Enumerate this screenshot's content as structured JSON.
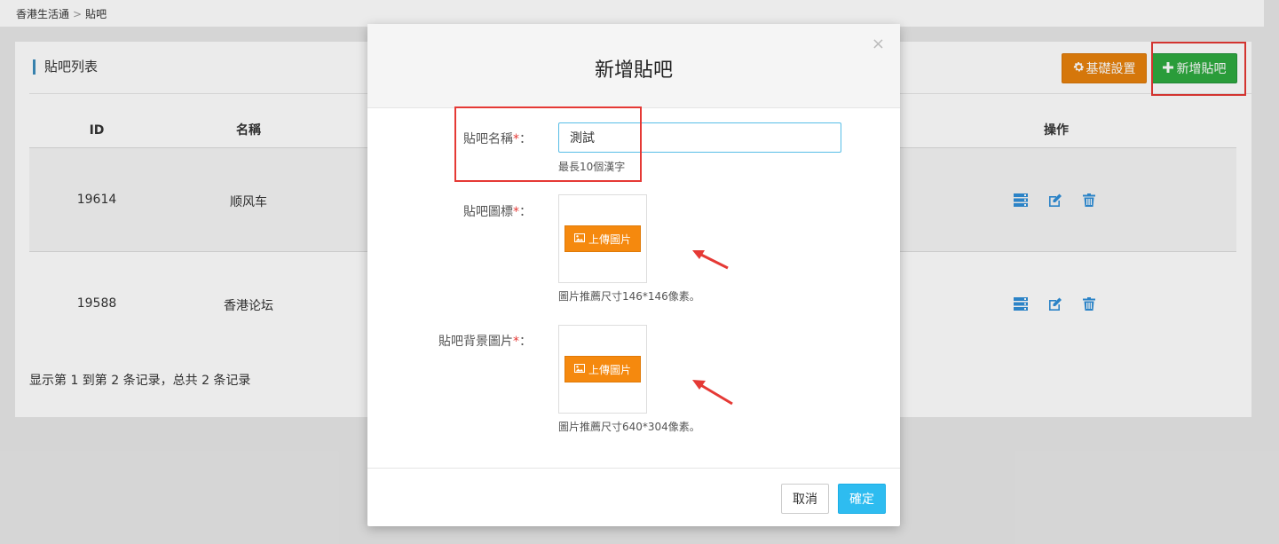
{
  "breadcrumb": {
    "home": "香港生活通",
    "separator": ">",
    "current": "貼吧"
  },
  "panel": {
    "title": "貼吧列表",
    "settings_button": "基礎設置",
    "add_button": "新增貼吧"
  },
  "table": {
    "headers": {
      "id": "ID",
      "name": "名稱",
      "actions": "操作"
    },
    "rows": [
      {
        "id": "19614",
        "name": "顺风车"
      },
      {
        "id": "19588",
        "name": "香港论坛"
      }
    ],
    "footer": "显示第 1 到第 2 条记录，总共 2 条记录"
  },
  "modal": {
    "title": "新增貼吧",
    "close": "×",
    "name_label": "貼吧名稱",
    "name_value": "測試",
    "name_help": "最長10個漢字",
    "icon_label": "貼吧圖標",
    "icon_upload": "上傳圖片",
    "icon_help": "圖片推薦尺寸146*146像素。",
    "bg_label": "貼吧背景圖片",
    "bg_upload": "上傳圖片",
    "bg_help": "圖片推薦尺寸640*304像素。",
    "required_mark": "*",
    "colon": "：",
    "cancel": "取消",
    "confirm": "確定"
  },
  "colors": {
    "settings_button": "#e8820c",
    "add_button": "#2eaa3f",
    "confirm_button": "#2ebcf0",
    "upload_button": "#f5890e",
    "annotation": "#e53935",
    "action_icon": "#2f8fd8"
  },
  "icons": {
    "settings": "gear-icon",
    "add": "plus-icon",
    "row_actions": [
      "list-icon",
      "edit-icon",
      "trash-icon"
    ],
    "upload": "image-icon"
  }
}
